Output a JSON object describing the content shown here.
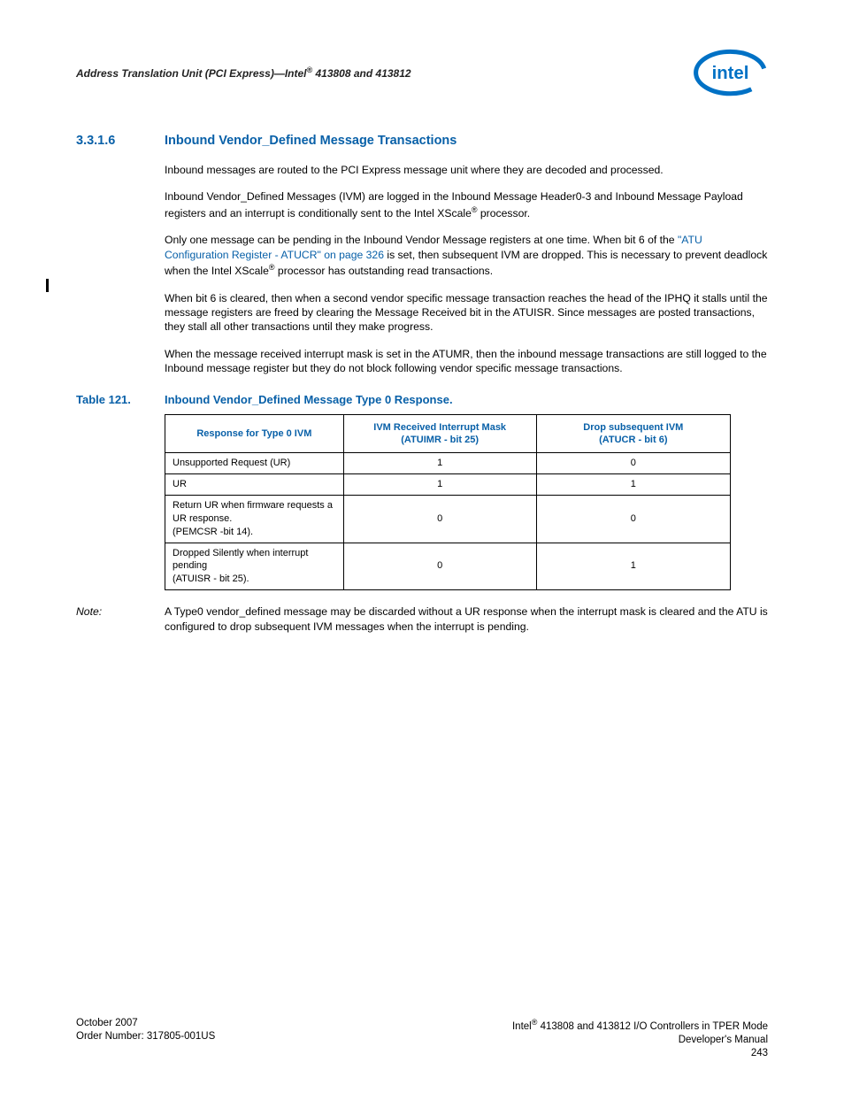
{
  "header": {
    "title_pre": "Address Translation Unit (PCI Express)—Intel",
    "title_post": " 413808 and 413812"
  },
  "section": {
    "number": "3.3.1.6",
    "title": "Inbound Vendor_Defined Message Transactions"
  },
  "paras": {
    "p1": "Inbound messages are routed to the PCI Express message unit where they are decoded and processed.",
    "p2a": "Inbound Vendor_Defined Messages (IVM) are logged in the Inbound Message Header0-3 and Inbound Message Payload registers and an interrupt is conditionally sent to the Intel XScale",
    "p2b": " processor.",
    "p3a": "Only one message can be pending in the Inbound Vendor Message registers at one time. When bit 6 of the ",
    "p3link": "\"ATU Configuration Register - ATUCR\" on page 326",
    "p3b": " is set, then subsequent IVM are dropped. This is necessary to prevent deadlock when the Intel XScale",
    "p3c": " processor has outstanding read transactions.",
    "p4": "When bit 6 is cleared, then when a second vendor specific message transaction reaches the head of the IPHQ it stalls until the message registers are freed by clearing the Message Received bit in the ATUISR. Since messages are posted transactions, they stall all other transactions until they make progress.",
    "p5": "When the message received interrupt mask is set in the ATUMR, then the inbound message transactions are still logged to the Inbound message register but they do not block following vendor specific message transactions."
  },
  "table": {
    "label": "Table 121.",
    "caption": "Inbound Vendor_Defined Message Type 0 Response.",
    "h1": "Response for Type 0 IVM",
    "h2a": "IVM Received Interrupt Mask",
    "h2b": "(ATUIMR - bit 25)",
    "h3a": "Drop subsequent IVM",
    "h3b": "(ATUCR - bit 6)",
    "rows": [
      {
        "c1": "Unsupported Request (UR)",
        "c2": "1",
        "c3": "0"
      },
      {
        "c1": "UR",
        "c2": "1",
        "c3": "1"
      },
      {
        "c1": "Return UR when firmware requests a UR response.\n(PEMCSR -bit 14).",
        "c2": "0",
        "c3": "0"
      },
      {
        "c1": "Dropped Silently when interrupt pending\n(ATUISR - bit 25).",
        "c2": "0",
        "c3": "1"
      }
    ]
  },
  "note": {
    "label": "Note:",
    "text": "A Type0 vendor_defined message may be discarded without a UR response when the interrupt mask is cleared and the ATU is configured to drop subsequent IVM messages when the interrupt is pending."
  },
  "footer": {
    "l1": "October 2007",
    "l2": "Order Number: 317805-001US",
    "r1a": "Intel",
    "r1b": " 413808 and 413812 I/O Controllers in TPER Mode",
    "r2": "Developer's Manual",
    "r3": "243"
  }
}
